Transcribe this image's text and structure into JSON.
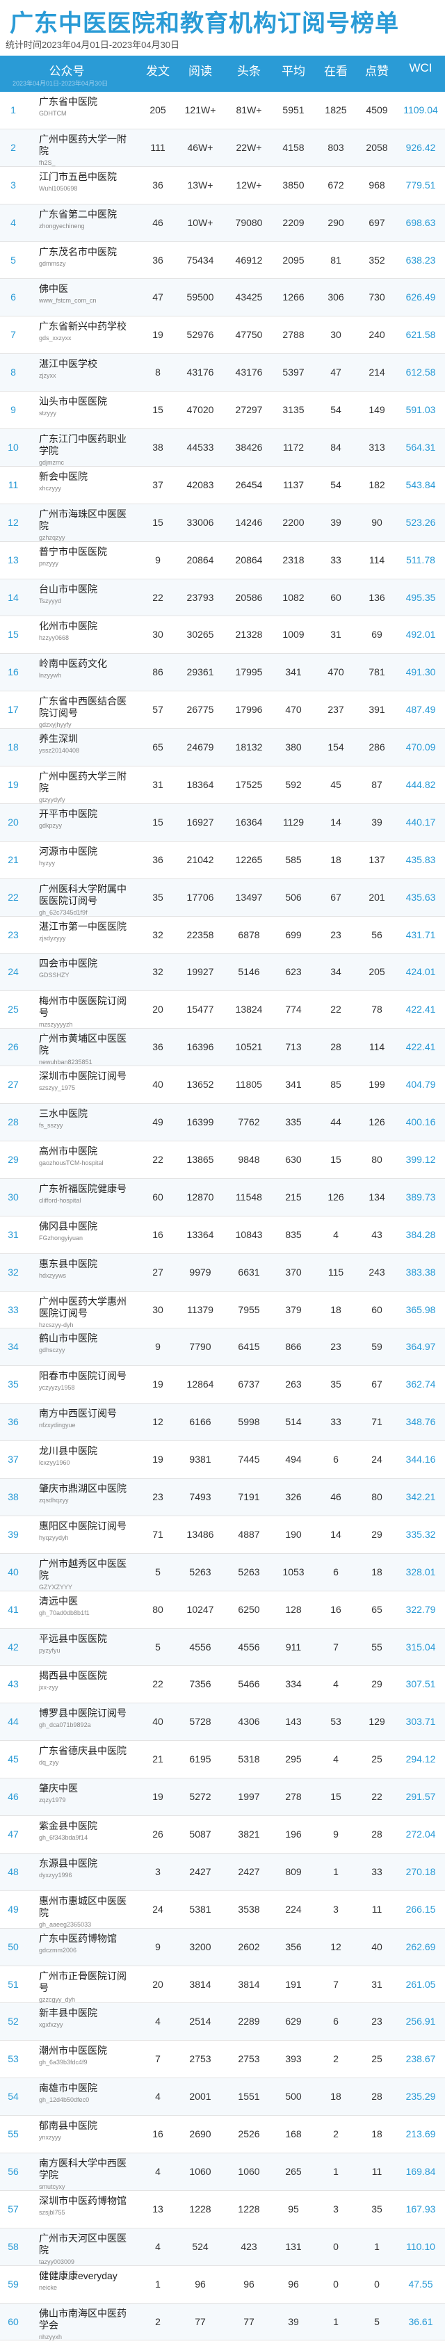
{
  "title": "广东中医医院和教育机构订阅号榜单",
  "subtitle": "统计时间2023年04月01日-2023年04月30日",
  "header": {
    "account": "公众号",
    "publish": "发文",
    "read": "阅读",
    "headline": "头条",
    "avg": "平均",
    "looking": "在看",
    "like": "点赞",
    "wci": "WCI",
    "note": "2023年04月01日-2023年04月30日"
  },
  "rows": [
    {
      "rank": "1",
      "name": "广东省中医院",
      "id": "GDHTCM",
      "pub": "205",
      "read": "121W+",
      "head": "81W+",
      "avg": "5951",
      "look": "1825",
      "like": "4509",
      "wci": "1109.04"
    },
    {
      "rank": "2",
      "name": "广州中医药大学一附院",
      "id": "fh2S_",
      "pub": "111",
      "read": "46W+",
      "head": "22W+",
      "avg": "4158",
      "look": "803",
      "like": "2058",
      "wci": "926.42"
    },
    {
      "rank": "3",
      "name": "江门市五邑中医院",
      "id": "Wuhl1050698",
      "pub": "36",
      "read": "13W+",
      "head": "12W+",
      "avg": "3850",
      "look": "672",
      "like": "968",
      "wci": "779.51"
    },
    {
      "rank": "4",
      "name": "广东省第二中医院",
      "id": "zhongyechineng",
      "pub": "46",
      "read": "10W+",
      "head": "79080",
      "avg": "2209",
      "look": "290",
      "like": "697",
      "wci": "698.63"
    },
    {
      "rank": "5",
      "name": "广东茂名市中医院",
      "id": "gdmmszy",
      "pub": "36",
      "read": "75434",
      "head": "46912",
      "avg": "2095",
      "look": "81",
      "like": "352",
      "wci": "638.23"
    },
    {
      "rank": "6",
      "name": "佛中医",
      "id": "www_fstcm_com_cn",
      "pub": "47",
      "read": "59500",
      "head": "43425",
      "avg": "1266",
      "look": "306",
      "like": "730",
      "wci": "626.49"
    },
    {
      "rank": "7",
      "name": "广东省新兴中药学校",
      "id": "gds_xxzyxx",
      "pub": "19",
      "read": "52976",
      "head": "47750",
      "avg": "2788",
      "look": "30",
      "like": "240",
      "wci": "621.58"
    },
    {
      "rank": "8",
      "name": "湛江中医学校",
      "id": "zjzyxx",
      "pub": "8",
      "read": "43176",
      "head": "43176",
      "avg": "5397",
      "look": "47",
      "like": "214",
      "wci": "612.58"
    },
    {
      "rank": "9",
      "name": "汕头市中医医院",
      "id": "stzyyy",
      "pub": "15",
      "read": "47020",
      "head": "27297",
      "avg": "3135",
      "look": "54",
      "like": "149",
      "wci": "591.03"
    },
    {
      "rank": "10",
      "name": "广东江门中医药职业学院",
      "id": "gdjmzmc",
      "pub": "38",
      "read": "44533",
      "head": "38426",
      "avg": "1172",
      "look": "84",
      "like": "313",
      "wci": "564.31"
    },
    {
      "rank": "11",
      "name": "新会中医院",
      "id": "xhczyyy",
      "pub": "37",
      "read": "42083",
      "head": "26454",
      "avg": "1137",
      "look": "54",
      "like": "182",
      "wci": "543.84"
    },
    {
      "rank": "12",
      "name": "广州市海珠区中医医院",
      "id": "gzhzqzyy",
      "pub": "15",
      "read": "33006",
      "head": "14246",
      "avg": "2200",
      "look": "39",
      "like": "90",
      "wci": "523.26"
    },
    {
      "rank": "13",
      "name": "普宁市中医医院",
      "id": "pnzyyy",
      "pub": "9",
      "read": "20864",
      "head": "20864",
      "avg": "2318",
      "look": "33",
      "like": "114",
      "wci": "511.78"
    },
    {
      "rank": "14",
      "name": "台山市中医院",
      "id": "Tszyyyd",
      "pub": "22",
      "read": "23793",
      "head": "20586",
      "avg": "1082",
      "look": "60",
      "like": "136",
      "wci": "495.35"
    },
    {
      "rank": "15",
      "name": "化州市中医院",
      "id": "hzzyy0668",
      "pub": "30",
      "read": "30265",
      "head": "21328",
      "avg": "1009",
      "look": "31",
      "like": "69",
      "wci": "492.01"
    },
    {
      "rank": "16",
      "name": "岭南中医药文化",
      "id": "lnzyywh",
      "pub": "86",
      "read": "29361",
      "head": "17995",
      "avg": "341",
      "look": "470",
      "like": "781",
      "wci": "491.30"
    },
    {
      "rank": "17",
      "name": "广东省中西医结合医院订阅号",
      "id": "gdzxyjhyyfy",
      "pub": "57",
      "read": "26775",
      "head": "17996",
      "avg": "470",
      "look": "237",
      "like": "391",
      "wci": "487.49"
    },
    {
      "rank": "18",
      "name": "养生深圳",
      "id": "yssz20140408",
      "pub": "65",
      "read": "24679",
      "head": "18132",
      "avg": "380",
      "look": "154",
      "like": "286",
      "wci": "470.09"
    },
    {
      "rank": "19",
      "name": "广州中医药大学三附院",
      "id": "gtzyydyfy",
      "pub": "31",
      "read": "18364",
      "head": "17525",
      "avg": "592",
      "look": "45",
      "like": "87",
      "wci": "444.82"
    },
    {
      "rank": "20",
      "name": "开平市中医院",
      "id": "gdkpzyy",
      "pub": "15",
      "read": "16927",
      "head": "16364",
      "avg": "1129",
      "look": "14",
      "like": "39",
      "wci": "440.17"
    },
    {
      "rank": "21",
      "name": "河源市中医院",
      "id": "hyzyy",
      "pub": "36",
      "read": "21042",
      "head": "12265",
      "avg": "585",
      "look": "18",
      "like": "137",
      "wci": "435.83"
    },
    {
      "rank": "22",
      "name": "广州医科大学附属中医医院订阅号",
      "id": "gh_62c7345d1f9f",
      "pub": "35",
      "read": "17706",
      "head": "13497",
      "avg": "506",
      "look": "67",
      "like": "201",
      "wci": "435.63"
    },
    {
      "rank": "23",
      "name": "湛江市第一中医医院",
      "id": "zjsdyzyyy",
      "pub": "32",
      "read": "22358",
      "head": "6878",
      "avg": "699",
      "look": "23",
      "like": "56",
      "wci": "431.71"
    },
    {
      "rank": "24",
      "name": "四会市中医院",
      "id": "GDSSHZY",
      "pub": "32",
      "read": "19927",
      "head": "5146",
      "avg": "623",
      "look": "34",
      "like": "205",
      "wci": "424.01"
    },
    {
      "rank": "25",
      "name": "梅州市中医医院订阅号",
      "id": "mzszyyyyzh",
      "pub": "20",
      "read": "15477",
      "head": "13824",
      "avg": "774",
      "look": "22",
      "like": "78",
      "wci": "422.41"
    },
    {
      "rank": "26",
      "name": "广州市黄埔区中医医院",
      "id": "newuhban8235851",
      "pub": "36",
      "read": "16396",
      "head": "10521",
      "avg": "713",
      "look": "28",
      "like": "114",
      "wci": "422.41"
    },
    {
      "rank": "27",
      "name": "深圳市中医院订阅号",
      "id": "szszyy_1975",
      "pub": "40",
      "read": "13652",
      "head": "11805",
      "avg": "341",
      "look": "85",
      "like": "199",
      "wci": "404.79"
    },
    {
      "rank": "28",
      "name": "三水中医院",
      "id": "fs_sszyy",
      "pub": "49",
      "read": "16399",
      "head": "7762",
      "avg": "335",
      "look": "44",
      "like": "126",
      "wci": "400.16"
    },
    {
      "rank": "29",
      "name": "高州市中医院",
      "id": "gaozhousTCM-hospital",
      "pub": "22",
      "read": "13865",
      "head": "9848",
      "avg": "630",
      "look": "15",
      "like": "80",
      "wci": "399.12"
    },
    {
      "rank": "30",
      "name": "广东祈福医院健康号",
      "id": "clifford-hospital",
      "pub": "60",
      "read": "12870",
      "head": "11548",
      "avg": "215",
      "look": "126",
      "like": "134",
      "wci": "389.73"
    },
    {
      "rank": "31",
      "name": "佛冈县中医院",
      "id": "FGzhongyiyuan",
      "pub": "16",
      "read": "13364",
      "head": "10843",
      "avg": "835",
      "look": "4",
      "like": "43",
      "wci": "384.28"
    },
    {
      "rank": "32",
      "name": "惠东县中医院",
      "id": "hdxzyyws",
      "pub": "27",
      "read": "9979",
      "head": "6631",
      "avg": "370",
      "look": "115",
      "like": "243",
      "wci": "383.38"
    },
    {
      "rank": "33",
      "name": "广州中医药大学惠州医院订阅号",
      "id": "hzcszyy-dyh",
      "pub": "30",
      "read": "11379",
      "head": "7955",
      "avg": "379",
      "look": "18",
      "like": "60",
      "wci": "365.98"
    },
    {
      "rank": "34",
      "name": "鹤山市中医院",
      "id": "gdhsczyy",
      "pub": "9",
      "read": "7790",
      "head": "6415",
      "avg": "866",
      "look": "23",
      "like": "59",
      "wci": "364.97"
    },
    {
      "rank": "35",
      "name": "阳春市中医院订阅号",
      "id": "yczyyzy1958",
      "pub": "19",
      "read": "12864",
      "head": "6737",
      "avg": "263",
      "look": "35",
      "like": "67",
      "wci": "362.74"
    },
    {
      "rank": "36",
      "name": "南方中西医订阅号",
      "id": "nfzxydingyue",
      "pub": "12",
      "read": "6166",
      "head": "5998",
      "avg": "514",
      "look": "33",
      "like": "71",
      "wci": "348.76"
    },
    {
      "rank": "37",
      "name": "龙川县中医院",
      "id": "lcxzyy1960",
      "pub": "19",
      "read": "9381",
      "head": "7445",
      "avg": "494",
      "look": "6",
      "like": "24",
      "wci": "344.16"
    },
    {
      "rank": "38",
      "name": "肇庆市鼎湖区中医院",
      "id": "zqsdhqzyy",
      "pub": "23",
      "read": "7493",
      "head": "7191",
      "avg": "326",
      "look": "46",
      "like": "80",
      "wci": "342.21"
    },
    {
      "rank": "39",
      "name": "惠阳区中医院订阅号",
      "id": "hyqzyydyh",
      "pub": "71",
      "read": "13486",
      "head": "4887",
      "avg": "190",
      "look": "14",
      "like": "29",
      "wci": "335.32"
    },
    {
      "rank": "40",
      "name": "广州市越秀区中医医院",
      "id": "GZYXZYYY",
      "pub": "5",
      "read": "5263",
      "head": "5263",
      "avg": "1053",
      "look": "6",
      "like": "18",
      "wci": "328.01"
    },
    {
      "rank": "41",
      "name": "清远中医",
      "id": "gh_70ad0db8b1f1",
      "pub": "80",
      "read": "10247",
      "head": "6250",
      "avg": "128",
      "look": "16",
      "like": "65",
      "wci": "322.79"
    },
    {
      "rank": "42",
      "name": "平远县中医医院",
      "id": "pyzyfyu",
      "pub": "5",
      "read": "4556",
      "head": "4556",
      "avg": "911",
      "look": "7",
      "like": "55",
      "wci": "315.04"
    },
    {
      "rank": "43",
      "name": "揭西县中医医院",
      "id": "jxx-zyy",
      "pub": "22",
      "read": "7356",
      "head": "5466",
      "avg": "334",
      "look": "4",
      "like": "29",
      "wci": "307.51"
    },
    {
      "rank": "44",
      "name": "博罗县中医院订阅号",
      "id": "gh_dca071b9892a",
      "pub": "40",
      "read": "5728",
      "head": "4306",
      "avg": "143",
      "look": "53",
      "like": "129",
      "wci": "303.71"
    },
    {
      "rank": "45",
      "name": "广东省德庆县中医院",
      "id": "dq_zyy",
      "pub": "21",
      "read": "6195",
      "head": "5318",
      "avg": "295",
      "look": "4",
      "like": "25",
      "wci": "294.12"
    },
    {
      "rank": "46",
      "name": "肇庆中医",
      "id": "zqzy1979",
      "pub": "19",
      "read": "5272",
      "head": "1997",
      "avg": "278",
      "look": "15",
      "like": "22",
      "wci": "291.57"
    },
    {
      "rank": "47",
      "name": "紫金县中医院",
      "id": "gh_6f343bda9f14",
      "pub": "26",
      "read": "5087",
      "head": "3821",
      "avg": "196",
      "look": "9",
      "like": "28",
      "wci": "272.04"
    },
    {
      "rank": "48",
      "name": "东源县中医院",
      "id": "dyxzyy1996",
      "pub": "3",
      "read": "2427",
      "head": "2427",
      "avg": "809",
      "look": "1",
      "like": "33",
      "wci": "270.18"
    },
    {
      "rank": "49",
      "name": "惠州市惠城区中医医院",
      "id": "gh_aaeeg2365033",
      "pub": "24",
      "read": "5381",
      "head": "3538",
      "avg": "224",
      "look": "3",
      "like": "11",
      "wci": "266.15"
    },
    {
      "rank": "50",
      "name": "广东中医药博物馆",
      "id": "gdczmm2006",
      "pub": "9",
      "read": "3200",
      "head": "2602",
      "avg": "356",
      "look": "12",
      "like": "40",
      "wci": "262.69"
    },
    {
      "rank": "51",
      "name": "广州市正骨医院订阅号",
      "id": "gzzcgyy_dyh",
      "pub": "20",
      "read": "3814",
      "head": "3814",
      "avg": "191",
      "look": "7",
      "like": "31",
      "wci": "261.05"
    },
    {
      "rank": "52",
      "name": "新丰县中医院",
      "id": "xgxfxzyy",
      "pub": "4",
      "read": "2514",
      "head": "2289",
      "avg": "629",
      "look": "6",
      "like": "23",
      "wci": "256.91"
    },
    {
      "rank": "53",
      "name": "潮州市中医医院",
      "id": "gh_6a39b3fdc4f9",
      "pub": "7",
      "read": "2753",
      "head": "2753",
      "avg": "393",
      "look": "2",
      "like": "25",
      "wci": "238.67"
    },
    {
      "rank": "54",
      "name": "南雄市中医院",
      "id": "gh_12d4b50dfec0",
      "pub": "4",
      "read": "2001",
      "head": "1551",
      "avg": "500",
      "look": "18",
      "like": "28",
      "wci": "235.29"
    },
    {
      "rank": "55",
      "name": "郁南县中医院",
      "id": "ynxzyyy",
      "pub": "16",
      "read": "2690",
      "head": "2526",
      "avg": "168",
      "look": "2",
      "like": "18",
      "wci": "213.69"
    },
    {
      "rank": "56",
      "name": "南方医科大学中西医学院",
      "id": "smutcyxy",
      "pub": "4",
      "read": "1060",
      "head": "1060",
      "avg": "265",
      "look": "1",
      "like": "11",
      "wci": "169.84"
    },
    {
      "rank": "57",
      "name": "深圳市中医药博物馆",
      "id": "szsjbl755",
      "pub": "13",
      "read": "1228",
      "head": "1228",
      "avg": "95",
      "look": "3",
      "like": "35",
      "wci": "167.93"
    },
    {
      "rank": "58",
      "name": "广州市天河区中医医院",
      "id": "tazyy003009",
      "pub": "4",
      "read": "524",
      "head": "423",
      "avg": "131",
      "look": "0",
      "like": "1",
      "wci": "110.10"
    },
    {
      "rank": "59",
      "name": "健健康康everyday",
      "id": "neicke",
      "pub": "1",
      "read": "96",
      "head": "96",
      "avg": "96",
      "look": "0",
      "like": "0",
      "wci": "47.55"
    },
    {
      "rank": "60",
      "name": "佛山市南海区中医药学会",
      "id": "nhzyyxh",
      "pub": "2",
      "read": "77",
      "head": "77",
      "avg": "39",
      "look": "1",
      "like": "5",
      "wci": "36.61"
    }
  ]
}
